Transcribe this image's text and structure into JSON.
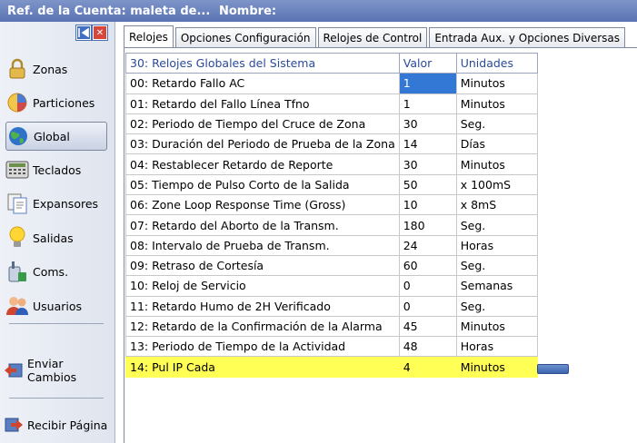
{
  "title_bar": {
    "account_ref": "Ref. de la Cuenta: maleta de...",
    "name_label": "Nombre:"
  },
  "sidebar": {
    "items": [
      {
        "label": "Zonas",
        "icon": "lock-icon"
      },
      {
        "label": "Particiones",
        "icon": "partitions-icon"
      },
      {
        "label": "Global",
        "icon": "globe-icon"
      },
      {
        "label": "Teclados",
        "icon": "keypad-icon"
      },
      {
        "label": "Expansores",
        "icon": "expanders-icon"
      },
      {
        "label": "Salidas",
        "icon": "lightbulb-icon"
      },
      {
        "label": "Coms.",
        "icon": "phone-icon"
      },
      {
        "label": "Usuarios",
        "icon": "users-icon"
      }
    ],
    "send": "Enviar Cambios",
    "receive": "Recibir Página"
  },
  "tabs": [
    "Relojes",
    "Opciones Configuración",
    "Relojes de Control",
    "Entrada Aux. y Opciones Diversas"
  ],
  "grid": {
    "headers": [
      "30: Relojes Globales del Sistema",
      "Valor",
      "Unidades"
    ],
    "rows": [
      [
        "00: Retardo Fallo AC",
        "1",
        "Minutos"
      ],
      [
        "01: Retardo del Fallo Línea Tfno",
        "1",
        "Minutos"
      ],
      [
        "02: Periodo de Tiempo del Cruce de Zona",
        "30",
        "Seg."
      ],
      [
        "03: Duración del Periodo de Prueba de la Zona",
        "14",
        "Días"
      ],
      [
        "04: Restablecer Retardo de Reporte",
        "30",
        "Minutos"
      ],
      [
        "05: Tiempo de Pulso Corto de la Salida",
        "50",
        "x 100mS"
      ],
      [
        "06: Zone Loop Response Time (Gross)",
        "10",
        "x 8mS"
      ],
      [
        "07: Retardo del Aborto de la Transm.",
        "180",
        "Seg."
      ],
      [
        "08: Intervalo de Prueba de Transm.",
        "24",
        "Horas"
      ],
      [
        "09: Retraso de Cortesía",
        "60",
        "Seg."
      ],
      [
        "10: Reloj de Servicio",
        "0",
        "Semanas"
      ],
      [
        "11: Retardo Humo de 2H Verificado",
        "0",
        "Seg."
      ],
      [
        "12: Retardo de la Confirmación de la Alarma",
        "45",
        "Minutos"
      ],
      [
        "13: Periodo de Tiempo de la Actividad",
        "48",
        "Horas"
      ],
      [
        "14: Pul IP Cada",
        "4",
        "Minutos"
      ]
    ]
  },
  "colors": {
    "title_bar": "#6a82be",
    "selected_cell": "#3478d6",
    "highlight_row": "#ffff55",
    "header_text": "#2a4a9a"
  }
}
